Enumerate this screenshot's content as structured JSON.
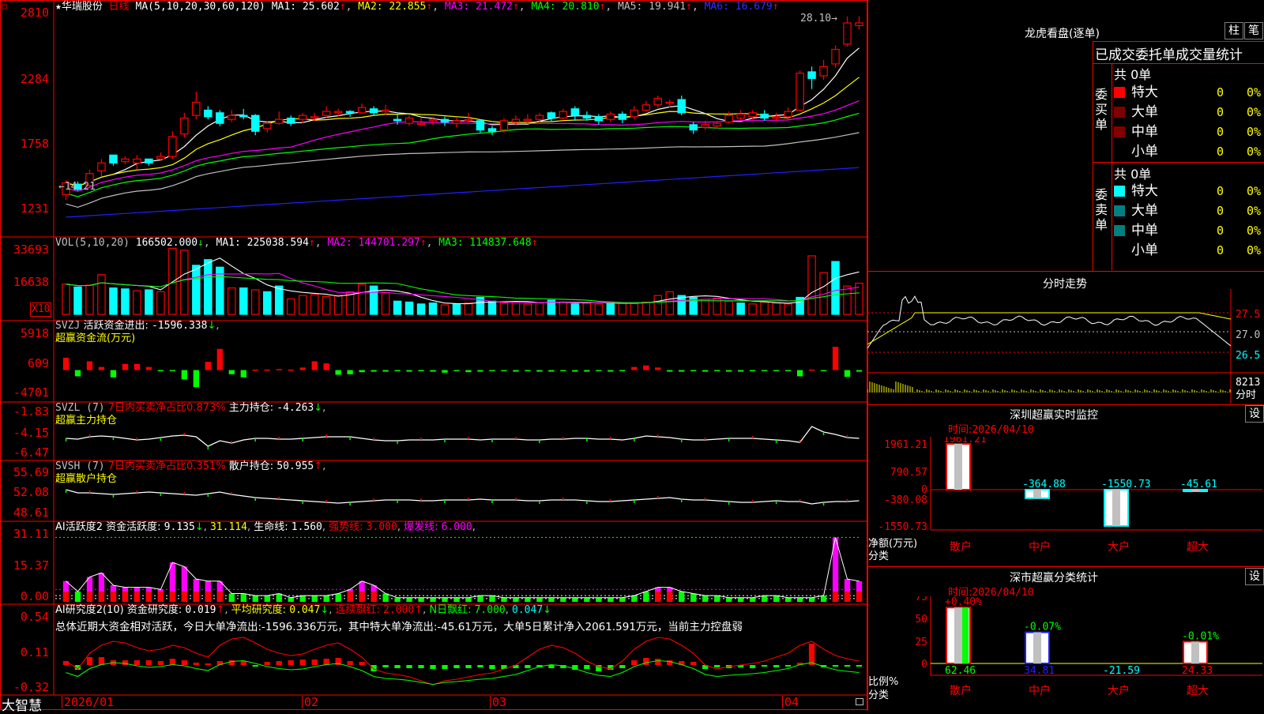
{
  "header": {
    "star": "★",
    "stock_name": "华瑞股份",
    "period": "日线",
    "ma_label": "MA(5,10,20,30,60,120)",
    "ma_values": [
      {
        "label": "MA1:",
        "value": "25.602",
        "arrow": "↑",
        "color": "#ffffff"
      },
      {
        "label": "MA2:",
        "value": "22.855",
        "arrow": "↑",
        "color": "#ffff00"
      },
      {
        "label": "MA3:",
        "value": "21.472",
        "arrow": "↑",
        "color": "#ff00ff"
      },
      {
        "label": "MA4:",
        "value": "20.810",
        "arrow": "↑",
        "color": "#00ff00"
      },
      {
        "label": "MA5:",
        "value": "19.941",
        "arrow": "↑",
        "color": "#c0c0c0"
      },
      {
        "label": "MA6:",
        "value": "16.679",
        "arrow": "↑",
        "color": "#3030ff"
      }
    ],
    "corner_mark": "□"
  },
  "price_panel": {
    "axis": [
      "2810",
      "2284",
      "1758",
      "1231"
    ],
    "high_label": "28.10",
    "low_label": "14.21",
    "candles": [
      {
        "o": 14.6,
        "c": 15.5,
        "h": 15.7,
        "l": 14.2
      },
      {
        "o": 15.4,
        "c": 15.0,
        "h": 15.6,
        "l": 14.9
      },
      {
        "o": 15.3,
        "c": 16.2,
        "h": 16.5,
        "l": 15.1
      },
      {
        "o": 16.4,
        "c": 17.0,
        "h": 17.3,
        "l": 16.0
      },
      {
        "o": 17.6,
        "c": 17.0,
        "h": 17.6,
        "l": 16.8
      },
      {
        "o": 17.1,
        "c": 17.3,
        "h": 17.5,
        "l": 16.9
      },
      {
        "o": 17.0,
        "c": 17.3,
        "h": 17.6,
        "l": 16.5
      },
      {
        "o": 17.3,
        "c": 17.0,
        "h": 17.3,
        "l": 16.8
      },
      {
        "o": 17.3,
        "c": 17.5,
        "h": 17.8,
        "l": 17.2
      },
      {
        "o": 17.5,
        "c": 19.0,
        "h": 19.4,
        "l": 17.3
      },
      {
        "o": 19.2,
        "c": 20.4,
        "h": 20.8,
        "l": 18.9
      },
      {
        "o": 20.6,
        "c": 21.6,
        "h": 22.4,
        "l": 20.3
      },
      {
        "o": 21.0,
        "c": 20.5,
        "h": 21.3,
        "l": 20.3
      },
      {
        "o": 20.8,
        "c": 20.0,
        "h": 21.0,
        "l": 19.8
      },
      {
        "o": 20.3,
        "c": 20.6,
        "h": 21.0,
        "l": 20.1
      },
      {
        "o": 20.6,
        "c": 20.5,
        "h": 21.1,
        "l": 20.3
      },
      {
        "o": 20.6,
        "c": 19.4,
        "h": 20.7,
        "l": 19.1
      },
      {
        "o": 19.6,
        "c": 20.0,
        "h": 20.2,
        "l": 19.3
      },
      {
        "o": 20.0,
        "c": 20.3,
        "h": 20.9,
        "l": 19.9
      },
      {
        "o": 20.4,
        "c": 20.0,
        "h": 20.6,
        "l": 19.8
      },
      {
        "o": 20.3,
        "c": 20.6,
        "h": 20.8,
        "l": 20.0
      },
      {
        "o": 20.4,
        "c": 20.5,
        "h": 20.8,
        "l": 20.2
      },
      {
        "o": 20.6,
        "c": 20.9,
        "h": 21.3,
        "l": 20.4
      },
      {
        "o": 20.8,
        "c": 20.9,
        "h": 21.1,
        "l": 20.5
      },
      {
        "o": 20.9,
        "c": 20.8,
        "h": 21.0,
        "l": 20.5
      },
      {
        "o": 20.8,
        "c": 21.2,
        "h": 21.5,
        "l": 20.7
      },
      {
        "o": 21.1,
        "c": 20.8,
        "h": 21.3,
        "l": 20.6
      },
      {
        "o": 20.9,
        "c": 21.0,
        "h": 21.4,
        "l": 20.6
      },
      {
        "o": 20.3,
        "c": 20.2,
        "h": 20.7,
        "l": 19.9
      },
      {
        "o": 20.0,
        "c": 20.4,
        "h": 20.6,
        "l": 19.8
      },
      {
        "o": 20.0,
        "c": 20.0,
        "h": 20.4,
        "l": 19.8
      },
      {
        "o": 20.2,
        "c": 20.3,
        "h": 20.5,
        "l": 19.9
      },
      {
        "o": 20.3,
        "c": 20.1,
        "h": 20.5,
        "l": 19.8
      },
      {
        "o": 20.0,
        "c": 20.2,
        "h": 20.4,
        "l": 19.7
      },
      {
        "o": 20.2,
        "c": 20.3,
        "h": 20.8,
        "l": 20.0
      },
      {
        "o": 20.2,
        "c": 19.5,
        "h": 20.3,
        "l": 19.3
      },
      {
        "o": 19.6,
        "c": 19.4,
        "h": 19.8,
        "l": 19.1
      },
      {
        "o": 19.5,
        "c": 20.2,
        "h": 20.4,
        "l": 19.3
      },
      {
        "o": 20.1,
        "c": 20.3,
        "h": 20.6,
        "l": 19.9
      },
      {
        "o": 20.2,
        "c": 20.3,
        "h": 20.7,
        "l": 20.0
      },
      {
        "o": 20.3,
        "c": 20.6,
        "h": 20.8,
        "l": 20.0
      },
      {
        "o": 20.8,
        "c": 20.4,
        "h": 20.9,
        "l": 20.1
      },
      {
        "o": 20.4,
        "c": 20.9,
        "h": 21.1,
        "l": 20.3
      },
      {
        "o": 21.1,
        "c": 20.6,
        "h": 21.3,
        "l": 20.2
      },
      {
        "o": 20.6,
        "c": 20.4,
        "h": 20.9,
        "l": 20.2
      },
      {
        "o": 20.5,
        "c": 20.2,
        "h": 20.7,
        "l": 19.9
      },
      {
        "o": 20.3,
        "c": 20.7,
        "h": 20.9,
        "l": 20.1
      },
      {
        "o": 20.7,
        "c": 20.3,
        "h": 20.9,
        "l": 20.0
      },
      {
        "o": 20.5,
        "c": 21.0,
        "h": 21.3,
        "l": 20.3
      },
      {
        "o": 21.0,
        "c": 21.4,
        "h": 21.7,
        "l": 20.9
      },
      {
        "o": 21.4,
        "c": 21.9,
        "h": 22.1,
        "l": 21.2
      },
      {
        "o": 21.6,
        "c": 21.6,
        "h": 21.8,
        "l": 21.2
      },
      {
        "o": 21.8,
        "c": 20.8,
        "h": 22.1,
        "l": 20.6
      },
      {
        "o": 19.9,
        "c": 19.5,
        "h": 20.1,
        "l": 19.2
      },
      {
        "o": 19.7,
        "c": 19.9,
        "h": 20.2,
        "l": 19.5
      },
      {
        "o": 19.8,
        "c": 20.0,
        "h": 20.2,
        "l": 19.6
      },
      {
        "o": 20.1,
        "c": 20.6,
        "h": 20.9,
        "l": 20.0
      },
      {
        "o": 20.4,
        "c": 20.7,
        "h": 21.0,
        "l": 20.3
      },
      {
        "o": 20.5,
        "c": 20.8,
        "h": 21.0,
        "l": 20.3
      },
      {
        "o": 20.7,
        "c": 20.4,
        "h": 21.0,
        "l": 20.2
      },
      {
        "o": 20.4,
        "c": 20.5,
        "h": 20.8,
        "l": 20.2
      },
      {
        "o": 20.5,
        "c": 20.9,
        "h": 21.2,
        "l": 20.3
      },
      {
        "o": 21.0,
        "c": 23.8,
        "h": 24.0,
        "l": 20.9
      },
      {
        "o": 23.9,
        "c": 23.4,
        "h": 24.3,
        "l": 22.6
      },
      {
        "o": 23.6,
        "c": 24.3,
        "h": 24.8,
        "l": 23.3
      },
      {
        "o": 24.5,
        "c": 25.6,
        "h": 25.9,
        "l": 24.2
      },
      {
        "o": 26.0,
        "c": 27.6,
        "h": 28.1,
        "l": 25.8
      },
      {
        "o": 27.4,
        "c": 27.6,
        "h": 28.1,
        "l": 27.1
      }
    ]
  },
  "vol_panel": {
    "title": "VOL(5,10,20)",
    "value": "166502.000",
    "value_arrow": "↓",
    "ma": [
      {
        "label": "MA1:",
        "value": "225038.594",
        "arrow": "↑",
        "color": "#ffffff"
      },
      {
        "label": "MA2:",
        "value": "144701.297",
        "arrow": "↑",
        "color": "#ff00ff"
      },
      {
        "label": "MA3:",
        "value": "114837.648",
        "arrow": "↑",
        "color": "#00ff00"
      }
    ],
    "axis": [
      "33693",
      "16638"
    ],
    "unit": "X10",
    "bars": [
      16000,
      14500,
      15500,
      21000,
      14000,
      13500,
      12500,
      13000,
      12000,
      35000,
      34000,
      26000,
      29000,
      25000,
      14000,
      14000,
      13000,
      12000,
      15000,
      8200,
      10000,
      10500,
      9500,
      10000,
      12000,
      16000,
      15000,
      11500,
      7000,
      6500,
      5500,
      6000,
      5000,
      5500,
      6000,
      9000,
      7000,
      6000,
      6500,
      5500,
      6000,
      7500,
      6500,
      5500,
      6000,
      5500,
      6500,
      6000,
      5800,
      6500,
      10000,
      12000,
      10000,
      9000,
      8000,
      8500,
      7000,
      6000,
      5500,
      6500,
      6000,
      5500,
      9000,
      31000,
      22000,
      28000,
      15000,
      16500
    ],
    "up": [
      0,
      1,
      0,
      0,
      1,
      1,
      0,
      1,
      0,
      0,
      0,
      1,
      1,
      1,
      0,
      1,
      0,
      1,
      1,
      0,
      0,
      0,
      0,
      0,
      0,
      0,
      1,
      0,
      1,
      1,
      1,
      1,
      0,
      1,
      0,
      1,
      1,
      0,
      0,
      0,
      0,
      1,
      0,
      1,
      0,
      0,
      1,
      0,
      0,
      0,
      0,
      0,
      1,
      1,
      0,
      0,
      0,
      1,
      0,
      0,
      0,
      0,
      1,
      0,
      0,
      1,
      0,
      0
    ]
  },
  "svzj_panel": {
    "title": "SVZJ",
    "label": "活跃资金进出:",
    "value": "-1596.338",
    "arrow": "↓",
    "sub": "超赢资金流(万元)",
    "axis": [
      "5918",
      "609",
      "-4701"
    ],
    "values": [
      2400,
      -1200,
      1700,
      600,
      -1400,
      1200,
      1200,
      600,
      -200,
      -200,
      -1800,
      -3300,
      1600,
      4100,
      -800,
      -1400,
      100,
      100,
      200,
      100,
      500,
      1700,
      1300,
      -900,
      -800,
      -400,
      -300,
      -300,
      -200,
      -300,
      -200,
      -300,
      -500,
      -200,
      -400,
      -300,
      -200,
      -200,
      -300,
      -200,
      -300,
      -300,
      -200,
      -300,
      -300,
      -200,
      -300,
      -200,
      600,
      900,
      500,
      -300,
      -300,
      -200,
      -300,
      -200,
      -300,
      -300,
      -200,
      -200,
      -200,
      -200,
      -1200,
      100,
      -200,
      4500,
      -1300,
      -300,
      -500,
      -1200
    ]
  },
  "svzl_panel": {
    "title": "SVZL (7)",
    "ratio_label": "7日内买卖净占比0.873%",
    "label": "主力持仓:",
    "value": "-4.263",
    "arrow": "↓",
    "sub": "超赢主力持仓",
    "axis": [
      "-1.83",
      "-4.15",
      "-6.47"
    ]
  },
  "svsh_panel": {
    "title": "SVSH (7)",
    "ratio_label": "7日内买卖净占比0.351%",
    "label": "散户持仓:",
    "value": "50.955",
    "arrow": "↑",
    "sub": "超赢散户持仓",
    "axis": [
      "55.69",
      "52.08",
      "48.61"
    ]
  },
  "ai1_panel": {
    "title": "AI活跃度2",
    "label": "资金活跃度:",
    "value": "9.135",
    "arrow1": "↓",
    "value2": "31.114",
    "label3": "生命线:",
    "value3": "1.560",
    "strong_label": "强势线:",
    "strong_value": "3.000",
    "burst_label": "爆发线:",
    "burst_value": "6.000",
    "axis": [
      "31.11",
      "15.37",
      "0.00"
    ],
    "values": [
      10,
      5,
      12,
      14,
      8,
      7,
      7,
      7,
      6,
      19,
      17,
      11,
      10,
      10,
      4,
      4,
      3,
      3,
      4,
      2,
      3,
      3,
      3,
      4,
      6,
      10,
      8,
      4,
      2,
      2,
      2,
      2,
      2,
      2,
      2,
      3,
      3,
      2,
      2,
      2,
      2,
      2,
      2,
      2,
      2,
      2,
      2,
      2,
      3,
      5,
      7,
      7,
      5,
      4,
      3,
      3,
      2,
      2,
      2,
      3,
      3,
      2,
      2,
      2,
      3,
      31,
      11,
      10,
      10,
      9
    ]
  },
  "ai2_panel": {
    "title": "AI研究度2(10)",
    "label": "资金研究度:",
    "value": "0.019",
    "arrow": "↑",
    "label2": "平均研究度:",
    "value2": "0.047",
    "arrow2": "↓",
    "label3": "连续飘红:",
    "value3": "2.000",
    "arrow3": "↑",
    "label4": "N日飘红:",
    "value4": "7.000",
    "value5": "0.047",
    "arrow5": "↓",
    "summary": "总体近期大资金相对活跃，今日大单净流出:-1596.336万元，其中特大单净流出:-45.61万元，大单5日累计净入2061.591万元，当前主力控盘弱",
    "axis": [
      "0.54",
      "0.11",
      "-0.32"
    ],
    "values": [
      0.05,
      -0.06,
      0.1,
      0.1,
      0.06,
      0.06,
      0.06,
      0.06,
      0.05,
      0.08,
      0.06,
      0.03,
      0.02,
      0.05,
      0.06,
      0.05,
      -0.02,
      0.04,
      0.05,
      0.06,
      0.07,
      0.07,
      0.08,
      0.09,
      0.05,
      0.04,
      -0.08,
      -0.03,
      -0.04,
      -0.04,
      -0.04,
      -0.05,
      -0.05,
      -0.04,
      -0.04,
      -0.03,
      -0.05,
      -0.05,
      -0.04,
      -0.04,
      -0.03,
      -0.04,
      -0.04,
      -0.06,
      -0.05,
      -0.08,
      -0.06,
      -0.04,
      0.06,
      0.09,
      0.08,
      0.06,
      0.05,
      0.04,
      -0.05,
      -0.03,
      -0.04,
      -0.03,
      -0.04,
      -0.02,
      -0.03,
      -0.02,
      0.03,
      0.27,
      -0.03,
      -0.02,
      -0.02,
      -0.02
    ]
  },
  "bottom_axis": {
    "brand": "大智慧",
    "dates": [
      "2026/01",
      "02",
      "03",
      "04"
    ]
  },
  "dragon": {
    "title": "龙虎看盘(逐单)",
    "btn_col": "柱",
    "btn_pen": "笔",
    "header": "已成交委托单成交量统计",
    "buy_label": "委买单",
    "sell_label": "委卖单",
    "buy_total": "共 0单",
    "sell_total": "共 0单",
    "buy_rows": [
      {
        "name": "特大",
        "qty": "0",
        "pct": "0%",
        "color": "#ff0000"
      },
      {
        "name": "大单",
        "qty": "0",
        "pct": "0%",
        "color": "#800000"
      },
      {
        "name": "中单",
        "qty": "0",
        "pct": "0%",
        "color": "#800000"
      },
      {
        "name": "小单",
        "qty": "0",
        "pct": "0%",
        "color": "#000000"
      }
    ],
    "sell_rows": [
      {
        "name": "特大",
        "qty": "0",
        "pct": "0%",
        "color": "#00ffff"
      },
      {
        "name": "大单",
        "qty": "0",
        "pct": "0%",
        "color": "#008080"
      },
      {
        "name": "中单",
        "qty": "0",
        "pct": "0%",
        "color": "#008080"
      },
      {
        "name": "小单",
        "qty": "0",
        "pct": "0%",
        "color": "#000000"
      }
    ]
  },
  "intraday": {
    "title": "分时走势",
    "axis": [
      "27.5",
      "27.0",
      "26.5"
    ],
    "vol_axis": [
      "8213",
      "分时"
    ]
  },
  "monitor": {
    "title": "深圳超赢实时监控",
    "btn": "设",
    "time_label": "时间:",
    "time": "2026/04/10",
    "axis": [
      "1961.21",
      "790.57",
      "0",
      "-380.08",
      "-1550.73"
    ],
    "unit1": "净额(万元)",
    "unit2": "分类",
    "cats": [
      {
        "name": "散户",
        "value": 1961.21,
        "label": "1961.21"
      },
      {
        "name": "中户",
        "value": -364.88,
        "label": "-364.88"
      },
      {
        "name": "大户",
        "value": -1550.73,
        "label": "-1550.73"
      },
      {
        "name": "超大",
        "value": -45.61,
        "label": "-45.61"
      }
    ]
  },
  "classify": {
    "title": "深市超赢分类统计",
    "btn": "设",
    "time_label": "时间:",
    "time": "2026/04/10",
    "axis": [
      "75",
      "50",
      "25",
      "0"
    ],
    "unit1": "比例%",
    "unit2": "分类",
    "cats": [
      {
        "name": "散户",
        "value": 62.46,
        "label": "62.46",
        "delta": "+0.40%",
        "color": "#ff0000",
        "val_color": "#00ff00"
      },
      {
        "name": "中户",
        "value": 34.81,
        "label": "34.81",
        "delta": "-0.07%",
        "color": "#2020ff",
        "val_color": "#2020ff"
      },
      {
        "name": "大户",
        "value": -21.59,
        "label": "-21.59",
        "delta": "",
        "color": "#00ffff",
        "val_color": "#00ffff"
      },
      {
        "name": "超大",
        "value": 24.33,
        "label": "24.33",
        "delta": "-0.01%",
        "color": "#ff0000",
        "val_color": "#ff0000"
      }
    ]
  }
}
